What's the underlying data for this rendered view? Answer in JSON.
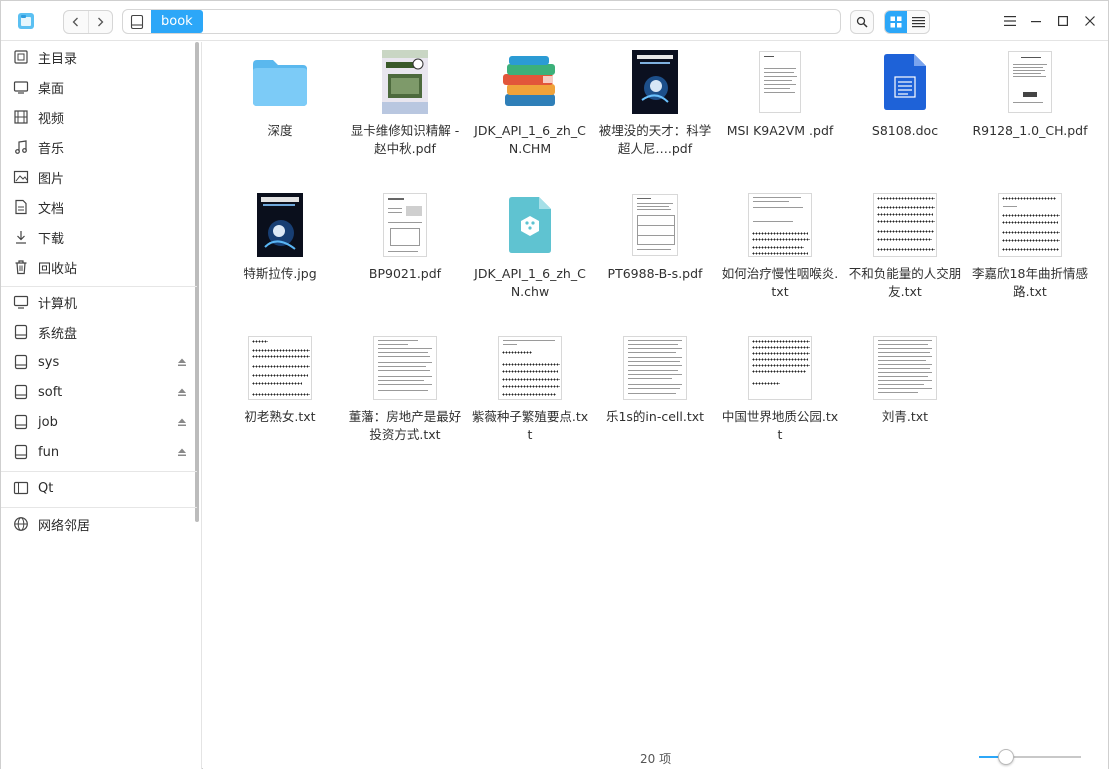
{
  "titlebar": {
    "breadcrumb": "book",
    "back_icon": "chevron-left-icon",
    "forward_icon": "chevron-right-icon",
    "search_icon": "search-icon",
    "icon_view_icon": "grid-view-icon",
    "list_view_icon": "list-view-icon",
    "menu_icon": "menu-icon",
    "minimize_icon": "minimize-icon",
    "maximize_icon": "maximize-icon",
    "close_icon": "close-icon"
  },
  "sidebar": {
    "items": [
      {
        "label": "主目录",
        "icon": "home-icon"
      },
      {
        "label": "桌面",
        "icon": "desktop-icon"
      },
      {
        "label": "视频",
        "icon": "video-icon"
      },
      {
        "label": "音乐",
        "icon": "music-icon"
      },
      {
        "label": "图片",
        "icon": "picture-icon"
      },
      {
        "label": "文档",
        "icon": "document-icon"
      },
      {
        "label": "下载",
        "icon": "download-icon"
      },
      {
        "label": "回收站",
        "icon": "trash-icon"
      },
      {
        "label": "计算机",
        "icon": "computer-icon"
      },
      {
        "label": "系统盘",
        "icon": "disk-icon"
      },
      {
        "label": "sys",
        "icon": "disk-icon"
      },
      {
        "label": "soft",
        "icon": "disk-icon"
      },
      {
        "label": "job",
        "icon": "disk-icon"
      },
      {
        "label": "fun",
        "icon": "disk-icon"
      },
      {
        "label": "Qt",
        "icon": "bookmark-icon"
      },
      {
        "label": "网络邻居",
        "icon": "network-icon"
      }
    ]
  },
  "files": [
    {
      "name": "深度",
      "type": "folder"
    },
    {
      "name": "显卡维修知识精解 - 赵中秋.pdf",
      "type": "book-cover-gpu"
    },
    {
      "name": "JDK_API_1_6_zh_CN.CHM",
      "type": "chm"
    },
    {
      "name": "被埋没的天才：科学超人尼…​.pdf",
      "type": "book-cover-tesla"
    },
    {
      "name": "MSI K9A2VM .pdf",
      "type": "pdf-doc"
    },
    {
      "name": "S8108.doc",
      "type": "word"
    },
    {
      "name": "R9128_1.0_CH.pdf",
      "type": "pdf-doc"
    },
    {
      "name": "特斯拉传.jpg",
      "type": "image-tesla"
    },
    {
      "name": "BP9021.pdf",
      "type": "pdf-doc"
    },
    {
      "name": "JDK_API_1_6_zh_CN.chw",
      "type": "chw"
    },
    {
      "name": "PT6988-B-s.pdf",
      "type": "pdf-doc"
    },
    {
      "name": "如何治疗慢性咽喉炎.txt",
      "type": "txt"
    },
    {
      "name": "不和负能量的人交朋友.txt",
      "type": "txt"
    },
    {
      "name": "李嘉欣18年曲折情感路.txt",
      "type": "txt"
    },
    {
      "name": "初老熟女.txt",
      "type": "txt"
    },
    {
      "name": "董藩：房地产是最好投资方式.txt",
      "type": "txt"
    },
    {
      "name": "紫薇种子繁殖要点.txt",
      "type": "txt"
    },
    {
      "name": "乐1s的in-cell.txt",
      "type": "txt"
    },
    {
      "name": "中国世界地质公园.txt",
      "type": "txt"
    },
    {
      "name": "刘青.txt",
      "type": "txt"
    }
  ],
  "status": {
    "item_count": "20 项",
    "zoom_level": 0.25
  },
  "colors": {
    "accent": "#2ca7f8",
    "folder": "#6cc4f5"
  }
}
